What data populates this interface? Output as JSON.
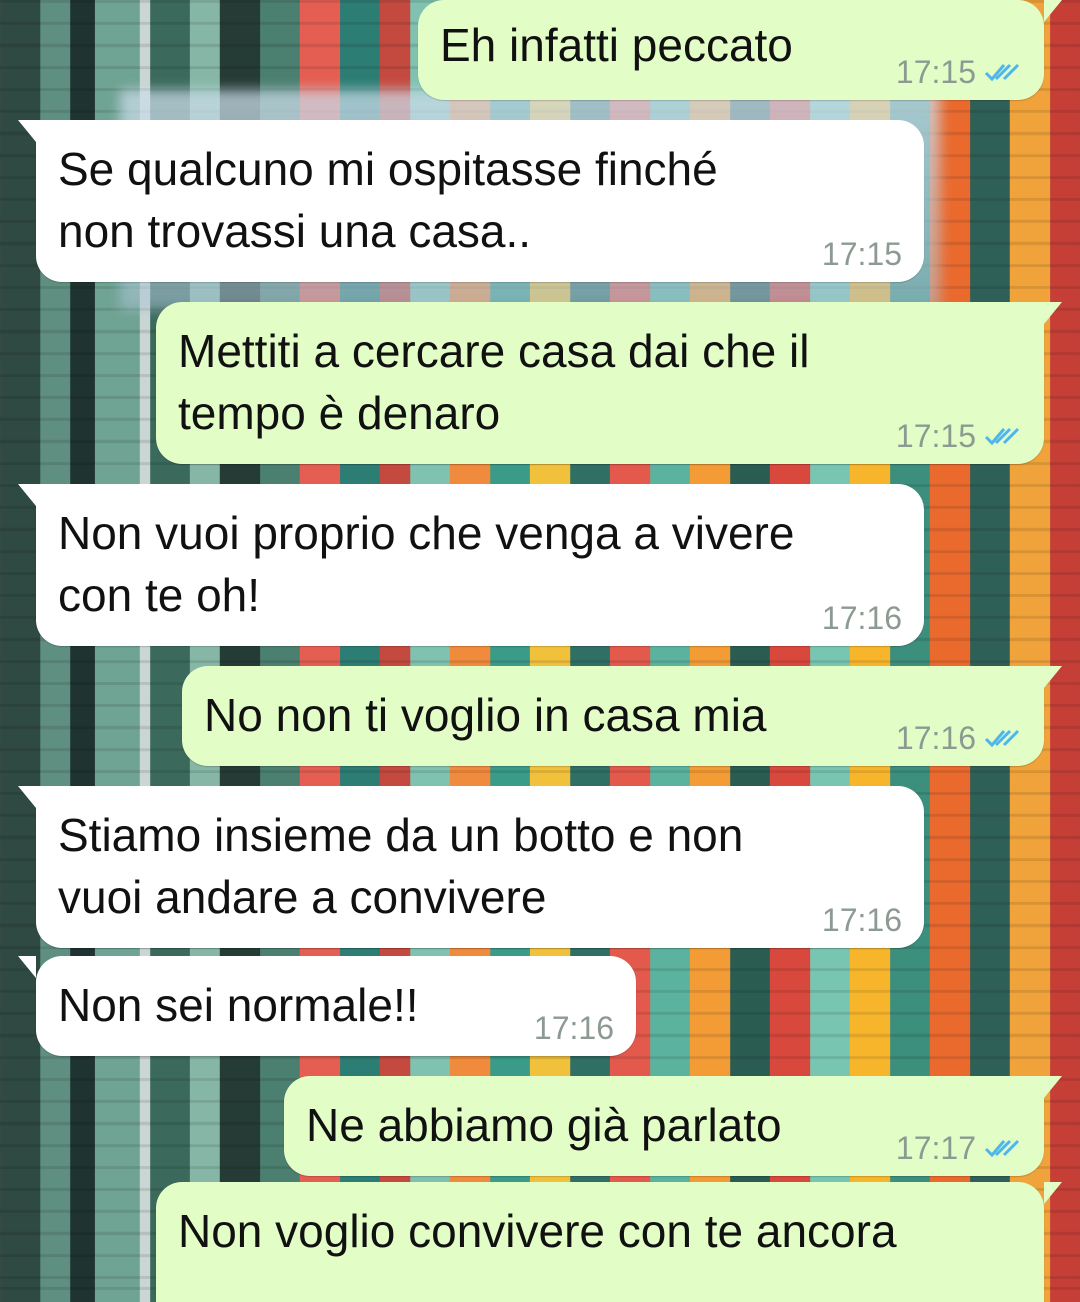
{
  "colors": {
    "incoming_bubble": "#ffffff",
    "outgoing_bubble": "#e2fec6",
    "read_ticks": "#4fb6ec",
    "timestamp": "#8c9a92"
  },
  "messages": [
    {
      "text": "Eh infatti peccato",
      "time": "17:15",
      "direction": "out",
      "status_icon": "double-check-read-icon"
    },
    {
      "text": "Se qualcuno mi ospitasse finché\nnon trovassi una casa..",
      "time": "17:15",
      "direction": "in"
    },
    {
      "text": "Mettiti a cercare casa dai che il\ntempo è denaro",
      "time": "17:15",
      "direction": "out",
      "status_icon": "double-check-read-icon"
    },
    {
      "text": "Non vuoi proprio che venga a vivere\ncon te oh!",
      "time": "17:16",
      "direction": "in"
    },
    {
      "text": "No non ti voglio in casa mia",
      "time": "17:16",
      "direction": "out",
      "status_icon": "double-check-read-icon"
    },
    {
      "text": "Stiamo insieme da un botto e non\nvuoi andare a convivere",
      "time": "17:16",
      "direction": "in"
    },
    {
      "text": "Non sei normale!!",
      "time": "17:16",
      "direction": "in"
    },
    {
      "text": "Ne abbiamo già parlato",
      "time": "17:17",
      "direction": "out",
      "status_icon": "double-check-read-icon"
    },
    {
      "text": "Non voglio convivere con te ancora",
      "time": "",
      "direction": "out"
    }
  ]
}
